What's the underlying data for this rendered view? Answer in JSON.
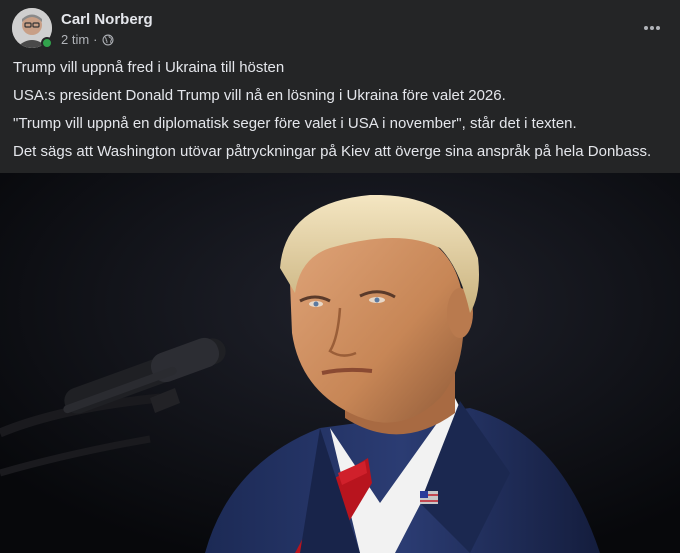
{
  "post": {
    "author": "Carl Norberg",
    "time": "2 tim",
    "separator": "·",
    "privacy_icon": "globe-icon",
    "more_icon": "more-options-icon",
    "online_color": "#31a24c",
    "paragraphs": [
      "Trump vill uppnå fred i Ukraina till hösten",
      "USA:s president Donald Trump vill nå en lösning i Ukraina före valet 2026.",
      "\"Trump vill uppnå en diplomatisk seger före valet i USA i november\", står det i texten.",
      "Det sägs att Washington utövar påtryckningar på Kiev att överge sina anspråk på hela Donbass."
    ]
  },
  "colors": {
    "background": "#242526",
    "text": "#e4e6eb",
    "secondary_text": "#b0b3b8"
  }
}
